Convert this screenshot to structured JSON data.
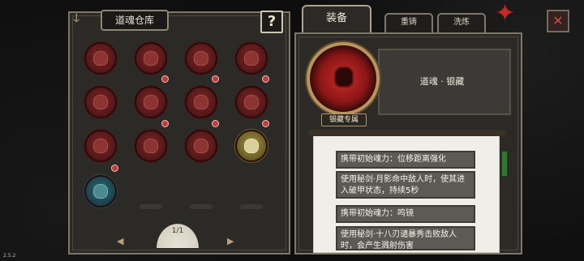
{
  "left_panel": {
    "title": "道魂仓库",
    "help_label": "?",
    "page_indicator": "1/1",
    "prev_arrow": "◀",
    "next_arrow": "▶"
  },
  "right_panel": {
    "tabs": [
      "装备",
      "重铸",
      "洗炼"
    ],
    "close_label": "✕",
    "soul_name": "道魂 · 银藏",
    "soul_tag": "银藏专属",
    "effects": [
      "携带初始魂力：位移距离强化",
      "使用秘剑·月影命中敌人时，使其进入破甲状态，持续5秒",
      "携带初始魂力：鸣镜",
      "使用秘剑·十八刃谴暴秀击败敌人时，会产生溅射伤害"
    ]
  },
  "version": "2.5.2",
  "colors": {
    "panel_bg": "#2b2a27",
    "border": "#7d7766",
    "soul_red": "#8c1616",
    "accent_gold": "#b8955c",
    "scroll_bg": "#efeee9"
  },
  "icons": [
    "help-icon",
    "close-icon",
    "pinwheel-icon",
    "fan-icon",
    "skull-orb-icon"
  ]
}
